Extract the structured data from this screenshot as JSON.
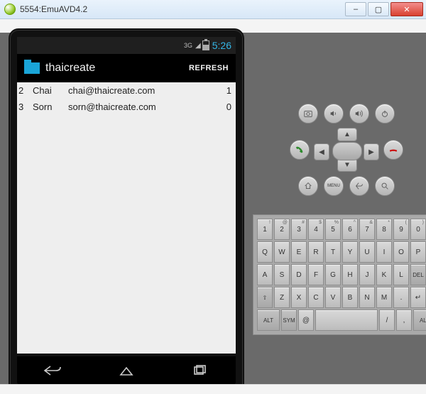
{
  "window": {
    "title": "5554:EmuAVD4.2"
  },
  "statusbar": {
    "net": "3G",
    "clock": "5:26"
  },
  "actionbar": {
    "title": "thaicreate",
    "refresh": "REFRESH"
  },
  "rows": [
    {
      "id": "2",
      "name": "Chai",
      "email": "chai@thaicreate.com",
      "status": "1"
    },
    {
      "id": "3",
      "name": "Sorn",
      "email": "sorn@thaicreate.com",
      "status": "0"
    }
  ],
  "hw": {
    "menu": "MENU",
    "alt": "ALT",
    "sym": "SYM",
    "del": "DEL"
  },
  "kbd": {
    "r1": [
      {
        "main": "1",
        "sub": "!"
      },
      {
        "main": "2",
        "sub": "@"
      },
      {
        "main": "3",
        "sub": "#"
      },
      {
        "main": "4",
        "sub": "$"
      },
      {
        "main": "5",
        "sub": "%"
      },
      {
        "main": "6",
        "sub": "^"
      },
      {
        "main": "7",
        "sub": "&"
      },
      {
        "main": "8",
        "sub": "*"
      },
      {
        "main": "9",
        "sub": "("
      },
      {
        "main": "0",
        "sub": ")"
      }
    ],
    "r2": [
      {
        "main": "Q"
      },
      {
        "main": "W"
      },
      {
        "main": "E"
      },
      {
        "main": "R"
      },
      {
        "main": "T"
      },
      {
        "main": "Y"
      },
      {
        "main": "U"
      },
      {
        "main": "I"
      },
      {
        "main": "O"
      },
      {
        "main": "P"
      }
    ],
    "r3": [
      {
        "main": "A"
      },
      {
        "main": "S"
      },
      {
        "main": "D"
      },
      {
        "main": "F"
      },
      {
        "main": "G"
      },
      {
        "main": "H"
      },
      {
        "main": "J"
      },
      {
        "main": "K"
      },
      {
        "main": "L"
      }
    ],
    "r4": [
      {
        "main": "Z"
      },
      {
        "main": "X"
      },
      {
        "main": "C"
      },
      {
        "main": "V"
      },
      {
        "main": "B"
      },
      {
        "main": "N"
      },
      {
        "main": "M"
      },
      {
        "main": "."
      },
      {
        "main": "↵"
      }
    ],
    "r5_at": "@",
    "r5_comma": ",",
    "r5_slash": "/",
    "r5_space": " "
  }
}
